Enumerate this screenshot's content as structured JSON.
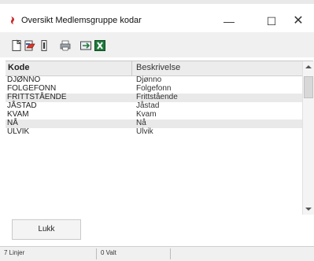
{
  "window": {
    "title": "Oversikt Medlemsgruppe kodar",
    "minimize": "—",
    "maximize": "☐",
    "close": "✕"
  },
  "toolbar": {
    "buttons": [
      "new-doc-icon",
      "open-icon",
      "delete-icon",
      "print-icon",
      "export-icon",
      "excel-icon"
    ]
  },
  "table": {
    "headers": {
      "kode": "Kode",
      "beskrivelse": "Beskrivelse"
    },
    "rows": [
      {
        "kode": "DJØNNO",
        "beskrivelse": "Djønno"
      },
      {
        "kode": "FOLGEFONN",
        "beskrivelse": "Folgefonn"
      },
      {
        "kode": "FRITTSTÅENDE",
        "beskrivelse": "Frittstående"
      },
      {
        "kode": "JÅSTAD",
        "beskrivelse": "Jåstad"
      },
      {
        "kode": "KVAM",
        "beskrivelse": "Kvam"
      },
      {
        "kode": "NÅ",
        "beskrivelse": "Nå"
      },
      {
        "kode": "ULVIK",
        "beskrivelse": "Ulvik"
      }
    ]
  },
  "buttons": {
    "lukk": "Lukk"
  },
  "status": {
    "lines": "7 Linjer",
    "selected": "0 Valt"
  },
  "colors": {
    "excel": "#1e7a3a",
    "accent": "#c62828"
  }
}
